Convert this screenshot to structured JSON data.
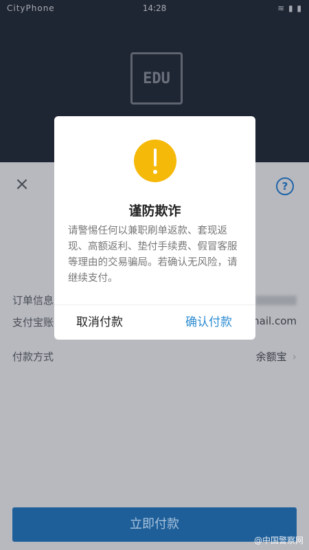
{
  "status_bar": {
    "carrier": "CityPhone",
    "time": "14:28",
    "icons": "≋ ▮ ▮"
  },
  "merchant": {
    "logo_text": "EDU",
    "name": ""
  },
  "sheet": {
    "close_icon": "×",
    "help_icon": "?",
    "rows": [
      {
        "label": "订单信息",
        "value": ""
      },
      {
        "label": "支付宝账",
        "value": "mail.com"
      },
      {
        "label": "付款方式",
        "value": "余额宝"
      }
    ],
    "pay_button": "立即付款"
  },
  "dialog": {
    "icon": "warning-icon",
    "title": "谨防欺诈",
    "body": "请警惕任何以兼职刷单返款、套现返现、高额返利、垫付手续费、假冒客服等理由的交易骗局。若确认无风险，请继续支付。",
    "cancel_label": "取消付款",
    "confirm_label": "确认付款"
  },
  "watermark": "@中国警察网",
  "colors": {
    "accent": "#2c8bd1",
    "warning": "#f5b90a",
    "pay_button": "#1e5f99"
  }
}
